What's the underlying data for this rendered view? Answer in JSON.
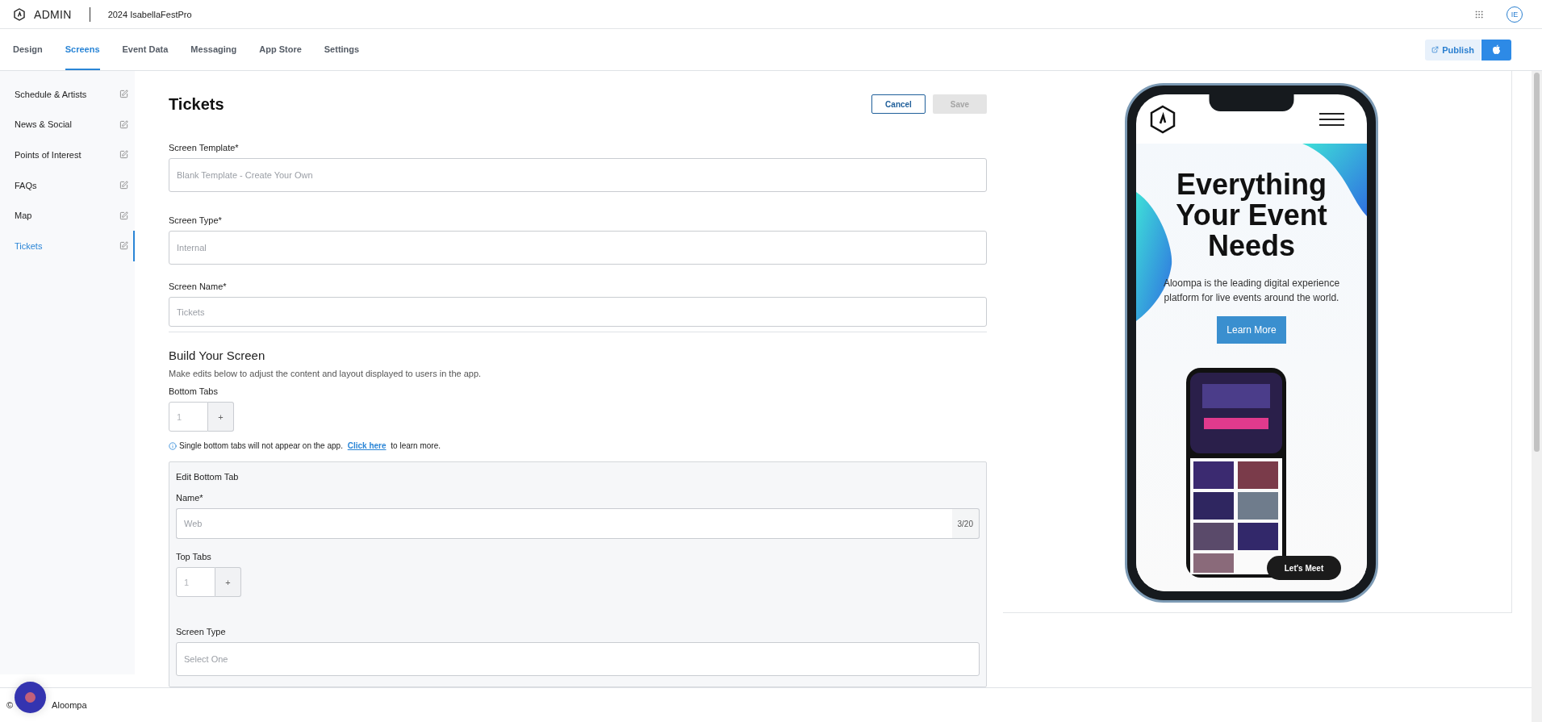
{
  "header": {
    "brand": "ADMIN",
    "project": "2024 IsabellaFestPro",
    "avatar": "IE"
  },
  "nav": {
    "tabs": [
      {
        "label": "Design",
        "selected": false
      },
      {
        "label": "Screens",
        "selected": true
      },
      {
        "label": "Event Data",
        "selected": false
      },
      {
        "label": "Messaging",
        "selected": false
      },
      {
        "label": "App Store",
        "selected": false
      },
      {
        "label": "Settings",
        "selected": false
      }
    ],
    "publish": "Publish"
  },
  "sidebar": {
    "items": [
      {
        "label": "Schedule & Artists",
        "selected": false
      },
      {
        "label": "News & Social",
        "selected": false
      },
      {
        "label": "Points of Interest",
        "selected": false
      },
      {
        "label": "FAQs",
        "selected": false
      },
      {
        "label": "Map",
        "selected": false
      },
      {
        "label": "Tickets",
        "selected": true
      }
    ]
  },
  "form": {
    "title": "Tickets",
    "cancel": "Cancel",
    "save": "Save",
    "save_disabled": true,
    "fields": [
      {
        "label": "Screen Template*",
        "placeholder": "Blank Template - Create Your Own"
      },
      {
        "label": "Screen Type*",
        "placeholder": "Internal"
      },
      {
        "label": "Screen Name*",
        "placeholder": "Tickets"
      }
    ],
    "build": {
      "title": "Build Your Screen",
      "description": "Make edits below to adjust the content and layout displayed to users in the app.",
      "bottom_tabs": {
        "label": "Bottom Tabs",
        "placeholder": "1",
        "add": "+"
      },
      "info": {
        "text": "Single bottom tabs will not appear on the app.",
        "link": "Click here",
        "after": "to learn more."
      },
      "edit_tab": {
        "title": "Edit Bottom Tab",
        "name": {
          "label": "Name*",
          "placeholder": "Web",
          "counter": "3/20"
        },
        "top_tabs": {
          "label": "Top Tabs",
          "placeholder": "1",
          "add": "+"
        },
        "screen_type": {
          "label": "Screen Type",
          "placeholder": "Select One"
        }
      }
    }
  },
  "preview": {
    "heading": "Everything Your Event Needs",
    "text": "Aloompa is the leading digital experience platform for live events around the world.",
    "button": "Learn More",
    "chat": "Let's Meet"
  },
  "footer": {
    "copyright": "©",
    "company": "Aloompa"
  }
}
